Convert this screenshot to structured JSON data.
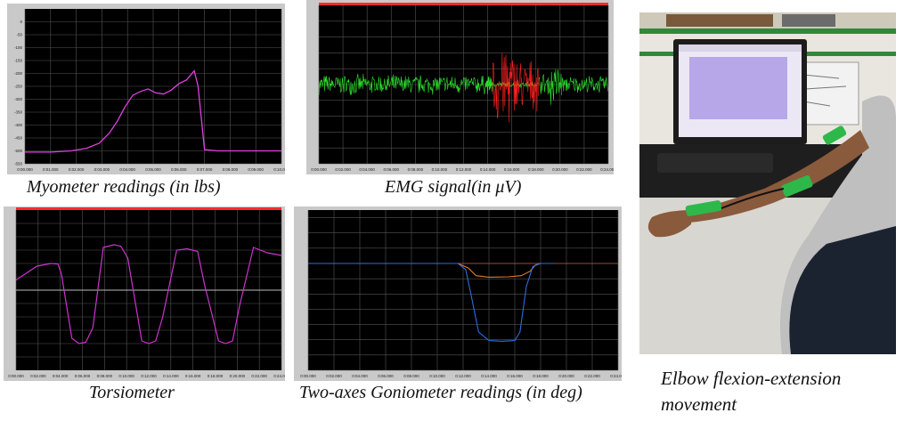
{
  "colors": {
    "plot_bg": "#000000",
    "frame": "#c9c9c9",
    "grid": "#555555",
    "myometer": "#e040e0",
    "emg_green": "#2ee62e",
    "emg_red": "#ff2020",
    "torsion": "#cc33cc",
    "gonio_orange": "#e07a2a",
    "gonio_blue": "#2f6ee0",
    "top_bar": "#ff2a2a"
  },
  "captions": {
    "myometer": "Myometer readings (in lbs)",
    "emg": "EMG signal(in μV)",
    "torsiometer": "Torsiometer",
    "goniometer": "Two-axes Goniometer readings (in deg)",
    "photo_line1": "Elbow flexion-extension",
    "photo_line2": "movement"
  },
  "chart_data": [
    {
      "id": "myometer",
      "type": "line",
      "title": "Myometer readings (in lbs)",
      "ylim": [
        -550,
        50
      ],
      "yticks": [
        0,
        -50,
        -100,
        -150,
        -200,
        -250,
        -300,
        -350,
        -400,
        -450,
        -500,
        -550
      ],
      "ytick_labels": [
        "0",
        "-50",
        "-100",
        "-150",
        "-200",
        "-250",
        "-300",
        "-350",
        "-400",
        "-450",
        "-500",
        "-550"
      ],
      "xlim": [
        0,
        10
      ],
      "xtick_labels": [
        "0:00.000",
        "0:01.000",
        "0:02.000",
        "0:03.000",
        "0:04.000",
        "0:05.000",
        "0:06.000",
        "0:07.000",
        "0:08.000",
        "0:09.000",
        "0:10.000"
      ],
      "grid": true,
      "series": [
        {
          "color": "#e040e0",
          "x": [
            0,
            1.0,
            1.8,
            2.4,
            2.9,
            3.3,
            3.6,
            3.9,
            4.2,
            4.5,
            4.8,
            5.1,
            5.4,
            5.7,
            6.0,
            6.3,
            6.6,
            6.75,
            7.0,
            7.5,
            8.0,
            9.0,
            10.0
          ],
          "y": [
            -505,
            -505,
            -500,
            -490,
            -470,
            -430,
            -385,
            -330,
            -285,
            -270,
            -260,
            -275,
            -280,
            -265,
            -240,
            -225,
            -190,
            -250,
            -495,
            -500,
            -500,
            -500,
            -500
          ]
        }
      ]
    },
    {
      "id": "emg",
      "type": "line",
      "title": "EMG signal(in μV)",
      "ylim": [
        -1000,
        1000
      ],
      "xlim": [
        0,
        0.25
      ],
      "xtick_labels": [
        "0:00.000",
        "0:02.000",
        "0:04.000",
        "0:06.000",
        "0:08.000",
        "0:10.000",
        "0:12.000",
        "0:14.000",
        "0:16.000",
        "0:18.000",
        "0:20.000",
        "0:22.000",
        "0:24.000"
      ],
      "grid": true,
      "series": [
        {
          "color": "#2ee62e",
          "envelope": [
            [
              0,
              0.15,
              140
            ],
            [
              0.15,
              0.145,
              110
            ],
            [
              0.145,
              0.19,
              40
            ],
            [
              0.19,
              0.2,
              160
            ],
            [
              0.2,
              0.21,
              300
            ],
            [
              0.21,
              0.25,
              120
            ]
          ]
        },
        {
          "color": "#ff2020",
          "envelope": [
            [
              0.15,
              0.165,
              600
            ],
            [
              0.165,
              0.175,
              450
            ],
            [
              0.175,
              0.19,
              350
            ]
          ]
        }
      ]
    },
    {
      "id": "torsiometer",
      "type": "line",
      "title": "Torsiometer",
      "ylim": [
        -3000,
        3000
      ],
      "xtick_labels": [
        "0:00.000",
        "0:02.000",
        "0:04.000",
        "0:06.000",
        "0:08.000",
        "0:10.000",
        "0:12.000",
        "0:14.000",
        "0:16.000",
        "0:18.000",
        "0:20.000",
        "0:22.000",
        "0:24.000"
      ],
      "grid": true,
      "series": [
        {
          "color": "#cc33cc",
          "x": [
            0,
            1.2,
            2.0,
            2.4,
            2.6,
            3.2,
            3.6,
            4.0,
            4.4,
            5.0,
            5.6,
            6.0,
            6.4,
            7.2,
            7.6,
            8.0,
            8.4,
            9.2,
            9.8,
            10.4,
            10.8,
            11.6,
            12.0,
            12.4,
            12.8,
            13.6,
            14.4,
            15.2
          ],
          "y": [
            380,
            900,
            1000,
            980,
            600,
            -1800,
            -2000,
            -1950,
            -1400,
            1600,
            1700,
            1650,
            1200,
            -1900,
            -2000,
            -1900,
            -1000,
            1500,
            1550,
            1450,
            200,
            -1900,
            -2000,
            -1900,
            -600,
            1600,
            1400,
            1300
          ]
        }
      ]
    },
    {
      "id": "goniometer",
      "type": "line",
      "title": "Two-axes Goniometer readings (in deg)",
      "ylim": [
        -1400,
        700
      ],
      "xtick_labels": [
        "0:00.000",
        "0:02.000",
        "0:04.000",
        "0:06.000",
        "0:08.000",
        "0:10.000",
        "0:12.000",
        "0:14.000",
        "0:16.000",
        "0:18.000",
        "0:20.000",
        "0:22.000",
        "0:24.000"
      ],
      "grid": true,
      "series": [
        {
          "color": "#e07a2a",
          "x": [
            0,
            11.6,
            12.4,
            13.0,
            14.0,
            15.5,
            16.5,
            17.2,
            17.6,
            18.0,
            19.0
          ],
          "y": [
            0,
            0,
            -60,
            -160,
            -180,
            -175,
            -160,
            -100,
            -20,
            0,
            0
          ]
        },
        {
          "color": "#2f6ee0",
          "x": [
            0,
            11.6,
            12.2,
            12.6,
            13.2,
            14.0,
            15.0,
            16.0,
            16.4,
            16.9,
            17.4,
            18.0,
            19.0
          ],
          "y": [
            0,
            0,
            -80,
            -400,
            -900,
            -1010,
            -1020,
            -1010,
            -900,
            -300,
            -40,
            0,
            0
          ]
        }
      ]
    }
  ]
}
